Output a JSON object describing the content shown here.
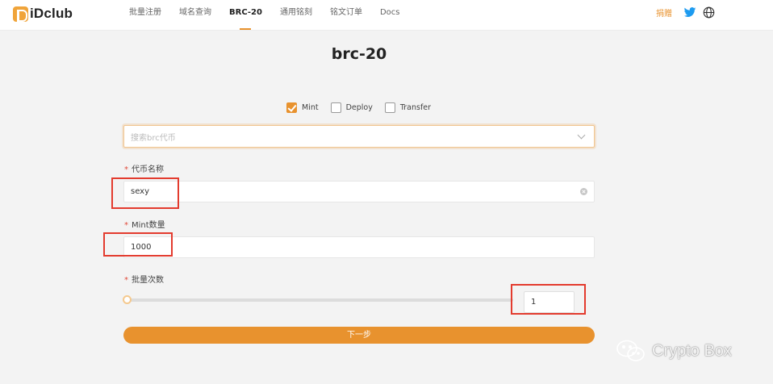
{
  "header": {
    "logo_text": "iDclub",
    "nav": [
      "批量注册",
      "域名查询",
      "BRC-20",
      "通用铭刻",
      "铭文订单",
      "Docs"
    ],
    "active_nav": "BRC-20",
    "donate_label": "捐赠",
    "icons": [
      "twitter-icon",
      "globe-icon"
    ]
  },
  "page": {
    "title": "brc-20",
    "ops": [
      {
        "label": "Mint",
        "checked": true
      },
      {
        "label": "Deploy",
        "checked": false
      },
      {
        "label": "Transfer",
        "checked": false
      }
    ],
    "search": {
      "placeholder": "搜索brc代币"
    },
    "fields": {
      "ticker": {
        "label": "代币名称",
        "value": "sexy"
      },
      "amount": {
        "label": "Mint数量",
        "value": "1000"
      },
      "batch": {
        "label": "批量次数",
        "value": "1"
      }
    },
    "next_button": "下一步"
  },
  "watermark": {
    "text": "Crypto Box"
  },
  "colors": {
    "accent": "#e8922e",
    "annotation": "#e33b2e",
    "required": "#e14b3b"
  }
}
